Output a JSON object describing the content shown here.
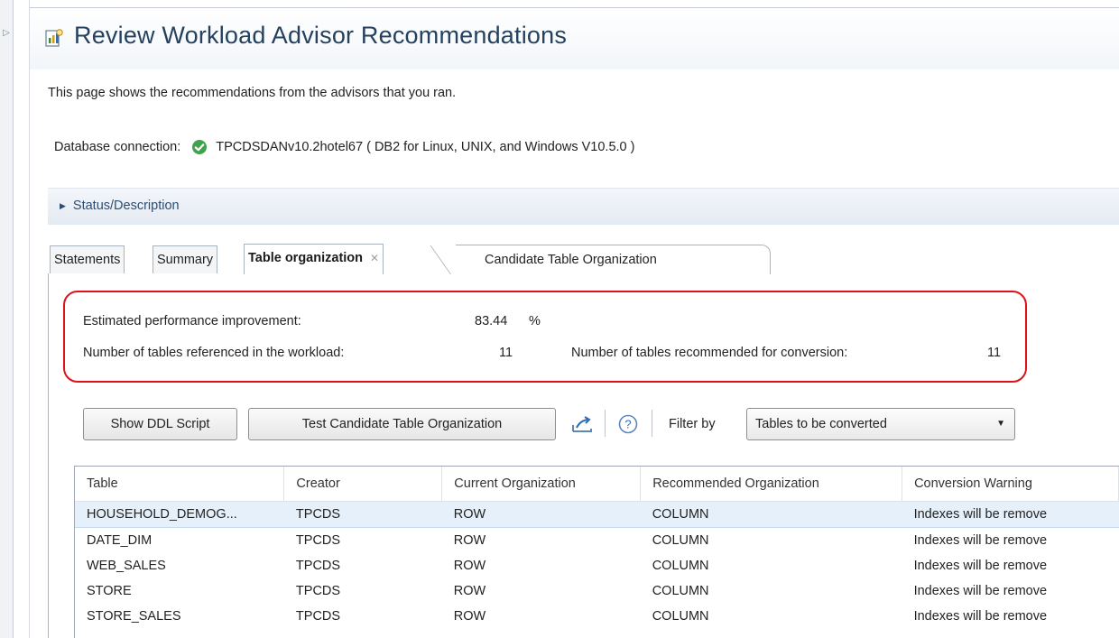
{
  "page": {
    "title": "Review Workload Advisor Recommendations",
    "description": "This page shows the recommendations from the advisors that you ran."
  },
  "connection": {
    "label": "Database connection:",
    "value": "TPCDSDANv10.2hotel67 ( DB2 for Linux, UNIX, and Windows V10.5.0 )",
    "status_color": "#3fa34d"
  },
  "status_section": {
    "label": "Status/Description"
  },
  "tabs": [
    {
      "label": "Statements",
      "active": false
    },
    {
      "label": "Summary",
      "active": false
    },
    {
      "label": "Table organization",
      "active": true
    },
    {
      "label": "Candidate Table Organization",
      "active": false
    }
  ],
  "stats": {
    "perf_label": "Estimated performance improvement:",
    "perf_value": "83.44",
    "perf_unit": "%",
    "tables_ref_label": "Number of tables referenced in the workload:",
    "tables_ref_value": "11",
    "tables_rec_label": "Number of tables recommended for conversion:",
    "tables_rec_value": "11",
    "highlight_color": "#e0101a"
  },
  "toolbar": {
    "show_ddl_label": "Show DDL Script",
    "test_candidate_label": "Test Candidate Table Organization",
    "export_icon": "export-icon",
    "help_icon": "help-icon",
    "filter_label": "Filter by",
    "filter_value": "Tables to be converted"
  },
  "table": {
    "columns": [
      "Table",
      "Creator",
      "Current Organization",
      "Recommended Organization",
      "Conversion Warning"
    ],
    "rows": [
      [
        "HOUSEHOLD_DEMOG...",
        "TPCDS",
        "ROW",
        "COLUMN",
        "Indexes will be remove"
      ],
      [
        "DATE_DIM",
        "TPCDS",
        "ROW",
        "COLUMN",
        "Indexes will be remove"
      ],
      [
        "WEB_SALES",
        "TPCDS",
        "ROW",
        "COLUMN",
        "Indexes will be remove"
      ],
      [
        "STORE",
        "TPCDS",
        "ROW",
        "COLUMN",
        "Indexes will be remove"
      ],
      [
        "STORE_SALES",
        "TPCDS",
        "ROW",
        "COLUMN",
        "Indexes will be remove"
      ]
    ]
  }
}
